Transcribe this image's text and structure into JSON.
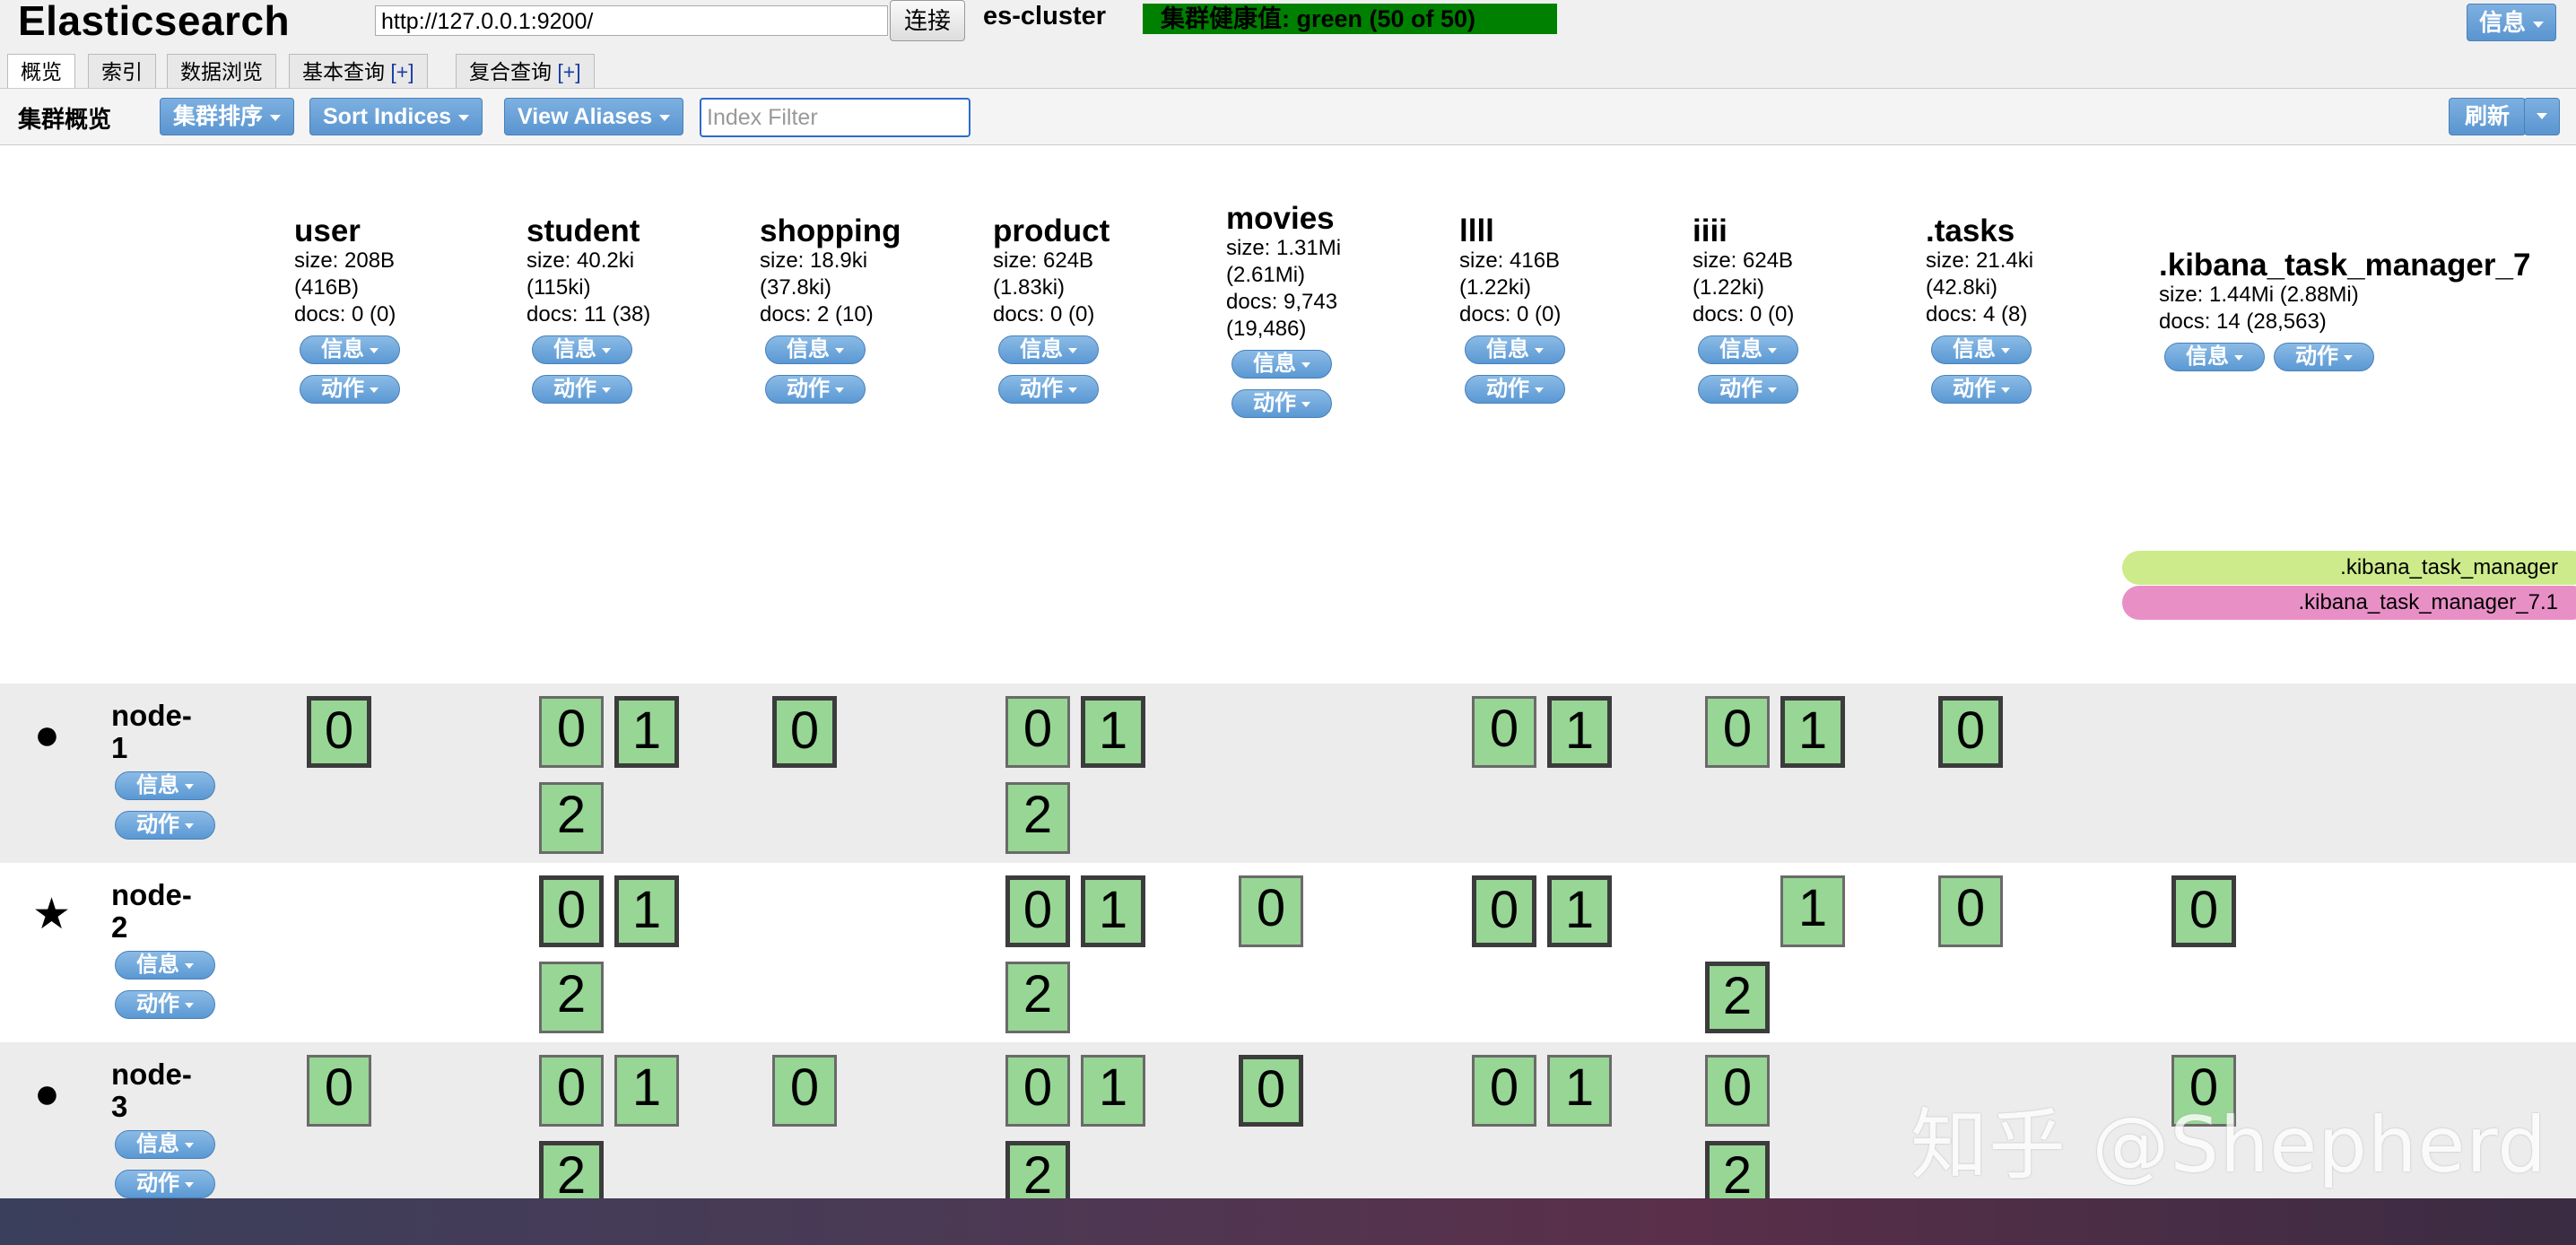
{
  "app": {
    "title": "Elasticsearch"
  },
  "header": {
    "url": "http://127.0.0.1:9200/",
    "connect_label": "连接",
    "cluster_name": "es-cluster",
    "health": "集群健康值: green (50 of 50)",
    "info_label": "信息"
  },
  "tabs": [
    {
      "label": "概览",
      "active": true
    },
    {
      "label": "索引"
    },
    {
      "label": "数据浏览"
    },
    {
      "label": "基本查询",
      "plus": "[+]"
    },
    {
      "label": "复合查询",
      "plus": "[+]"
    }
  ],
  "toolbar": {
    "title": "集群概览",
    "sort_cluster": "集群排序",
    "sort_indices": "Sort Indices",
    "view_aliases": "View Aliases",
    "filter_placeholder": "Index Filter",
    "refresh": "刷新"
  },
  "buttons": {
    "info": "信息",
    "action": "动作"
  },
  "indices": [
    {
      "name": "user",
      "size_lines": [
        "size: 208B",
        "(416B)"
      ],
      "docs_lines": [
        "docs: 0 (0)"
      ]
    },
    {
      "name": "student",
      "size_lines": [
        "size: 40.2ki",
        "(115ki)"
      ],
      "docs_lines": [
        "docs: 11 (38)"
      ]
    },
    {
      "name": "shopping",
      "size_lines": [
        "size: 18.9ki",
        "(37.8ki)"
      ],
      "docs_lines": [
        "docs: 2 (10)"
      ]
    },
    {
      "name": "product",
      "size_lines": [
        "size: 624B",
        "(1.83ki)"
      ],
      "docs_lines": [
        "docs: 0 (0)"
      ]
    },
    {
      "name": "movies",
      "size_lines": [
        "size: 1.31Mi",
        "(2.61Mi)"
      ],
      "docs_lines": [
        "docs: 9,743",
        "(19,486)"
      ]
    },
    {
      "name": "llll",
      "size_lines": [
        "size: 416B",
        "(1.22ki)"
      ],
      "docs_lines": [
        "docs: 0 (0)"
      ]
    },
    {
      "name": "iiii",
      "size_lines": [
        "size: 624B",
        "(1.22ki)"
      ],
      "docs_lines": [
        "docs: 0 (0)"
      ]
    },
    {
      "name": ".tasks",
      "size_lines": [
        "size: 21.4ki",
        "(42.8ki)"
      ],
      "docs_lines": [
        "docs: 4 (8)"
      ]
    },
    {
      "name": ".kibana_task_manager_7",
      "size_lines": [
        "size: 1.44Mi (2.88Mi)"
      ],
      "docs_lines": [
        "docs: 14 (28,563)"
      ]
    }
  ],
  "aliases": [
    {
      "label": ".kibana_task_manager",
      "color": "#cdeb8b"
    },
    {
      "label": ".kibana_task_manager_7.1",
      "color": "#e88fc6"
    }
  ],
  "nodes": [
    {
      "name_lines": [
        "node-",
        "1"
      ],
      "icon": "circle-icon",
      "glyph": "●",
      "shaded": true,
      "shards": [
        {
          "index": "user",
          "num": "0",
          "kind": "primary"
        },
        {
          "index": "student",
          "num": "0",
          "kind": "replica"
        },
        {
          "index": "student",
          "num": "1",
          "kind": "primary"
        },
        {
          "index": "student",
          "num": "2",
          "kind": "replica"
        },
        {
          "index": "shopping",
          "num": "0",
          "kind": "primary"
        },
        {
          "index": "product",
          "num": "0",
          "kind": "replica"
        },
        {
          "index": "product",
          "num": "1",
          "kind": "primary"
        },
        {
          "index": "product",
          "num": "2",
          "kind": "replica"
        },
        {
          "index": "llll",
          "num": "0",
          "kind": "replica"
        },
        {
          "index": "llll",
          "num": "1",
          "kind": "primary"
        },
        {
          "index": "iiii",
          "num": "0",
          "kind": "replica"
        },
        {
          "index": "iiii",
          "num": "1",
          "kind": "primary"
        },
        {
          "index": ".tasks",
          "num": "0",
          "kind": "primary"
        }
      ]
    },
    {
      "name_lines": [
        "node-",
        "2"
      ],
      "icon": "star-icon",
      "glyph": "★",
      "shaded": false,
      "shards": [
        {
          "index": "student",
          "num": "0",
          "kind": "primary"
        },
        {
          "index": "student",
          "num": "1",
          "kind": "primary"
        },
        {
          "index": "student",
          "num": "2",
          "kind": "replica"
        },
        {
          "index": "product",
          "num": "0",
          "kind": "primary"
        },
        {
          "index": "product",
          "num": "1",
          "kind": "primary"
        },
        {
          "index": "product",
          "num": "2",
          "kind": "replica"
        },
        {
          "index": "movies",
          "num": "0",
          "kind": "replica"
        },
        {
          "index": "llll",
          "num": "0",
          "kind": "primary"
        },
        {
          "index": "llll",
          "num": "1",
          "kind": "primary"
        },
        {
          "index": "iiii",
          "num": "1",
          "kind": "replica"
        },
        {
          "index": "iiii",
          "num": "2",
          "kind": "primary"
        },
        {
          "index": ".tasks",
          "num": "0",
          "kind": "replica"
        },
        {
          "index": ".kibana_task_manager_7",
          "num": "0",
          "kind": "primary"
        }
      ]
    },
    {
      "name_lines": [
        "node-",
        "3"
      ],
      "icon": "circle-icon",
      "glyph": "●",
      "shaded": true,
      "shards": [
        {
          "index": "user",
          "num": "0",
          "kind": "replica"
        },
        {
          "index": "student",
          "num": "0",
          "kind": "replica"
        },
        {
          "index": "student",
          "num": "1",
          "kind": "replica"
        },
        {
          "index": "student",
          "num": "2",
          "kind": "primary"
        },
        {
          "index": "shopping",
          "num": "0",
          "kind": "replica"
        },
        {
          "index": "product",
          "num": "0",
          "kind": "replica"
        },
        {
          "index": "product",
          "num": "1",
          "kind": "replica"
        },
        {
          "index": "product",
          "num": "2",
          "kind": "primary"
        },
        {
          "index": "movies",
          "num": "0",
          "kind": "primary"
        },
        {
          "index": "llll",
          "num": "0",
          "kind": "replica"
        },
        {
          "index": "llll",
          "num": "1",
          "kind": "replica"
        },
        {
          "index": "iiii",
          "num": "0",
          "kind": "replica"
        },
        {
          "index": "iiii",
          "num": "2",
          "kind": "primary"
        },
        {
          "index": ".kibana_task_manager_7",
          "num": "0",
          "kind": "replica"
        }
      ]
    }
  ],
  "colors": {
    "health": "#008000",
    "shard_fill": "#97d695",
    "node_row_shade": "#ececec",
    "button_blue": "#5a98d3"
  },
  "watermark": "知乎 @Shepherd"
}
